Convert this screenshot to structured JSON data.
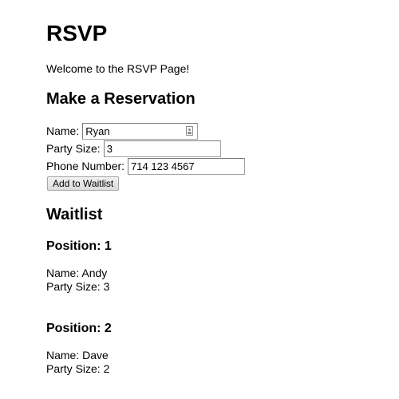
{
  "page": {
    "title": "RSVP",
    "welcome": "Welcome to the RSVP Page!"
  },
  "reservation": {
    "heading": "Make a Reservation",
    "name_label": "Name:",
    "name_value": "Ryan",
    "party_size_label": "Party Size:",
    "party_size_value": "3",
    "phone_label": "Phone Number:",
    "phone_value": "714 123 4567",
    "submit_label": "Add to Waitlist"
  },
  "waitlist": {
    "heading": "Waitlist",
    "entries": [
      {
        "position": "Position: 1",
        "name": "Name: Andy",
        "party_size": "Party Size: 3"
      },
      {
        "position": "Position: 2",
        "name": "Name: Dave",
        "party_size": "Party Size: 2"
      }
    ]
  },
  "icons": {
    "name_field_icon": "contact-autofill-icon"
  }
}
